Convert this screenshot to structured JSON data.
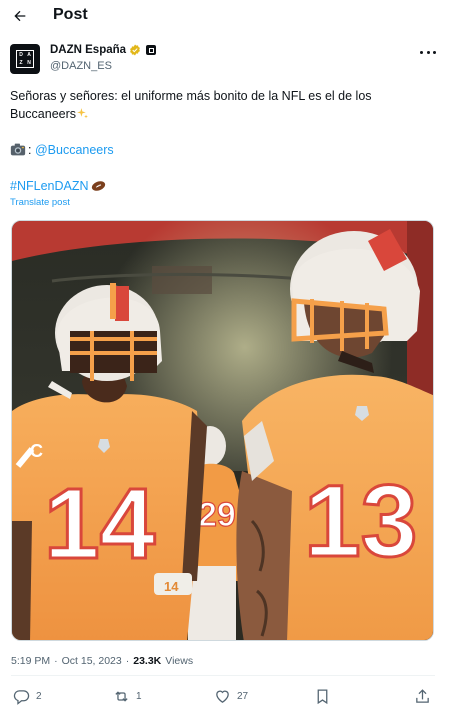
{
  "header": {
    "title": "Post",
    "back_icon": "arrow-left-icon"
  },
  "author": {
    "name": "DAZN España",
    "handle": "@DAZN_ES",
    "avatar_letters": [
      "D",
      "A",
      "Z",
      "N"
    ],
    "verified_color": "#e2b719"
  },
  "tweet": {
    "line1": "Señoras y señores: el uniforme más bonito de la NFL es el de los",
    "line2": "Buccaneers",
    "photo_prefix": ":",
    "mention": "@Buccaneers",
    "hashtag": "#NFLenDAZN",
    "translate_label": "Translate post"
  },
  "media": {
    "jersey_left": "14",
    "jersey_right": "13",
    "jersey_back": "29",
    "captain_patch": "C",
    "wristband_number": "14",
    "colors": {
      "jersey": "#f5a04a",
      "number": "#ffffff",
      "number_outline": "#d9473b",
      "helmet": "#ece8e2",
      "tunnel_red": "#b83a32"
    }
  },
  "meta": {
    "time": "5:19 PM",
    "sep": "·",
    "date": "Oct 15, 2023",
    "sep2": "·",
    "views_count": "23.3K",
    "views_label": "Views"
  },
  "actions": {
    "replies": "2",
    "reposts": "1",
    "likes": "27"
  },
  "accent": "#1d9bf0"
}
